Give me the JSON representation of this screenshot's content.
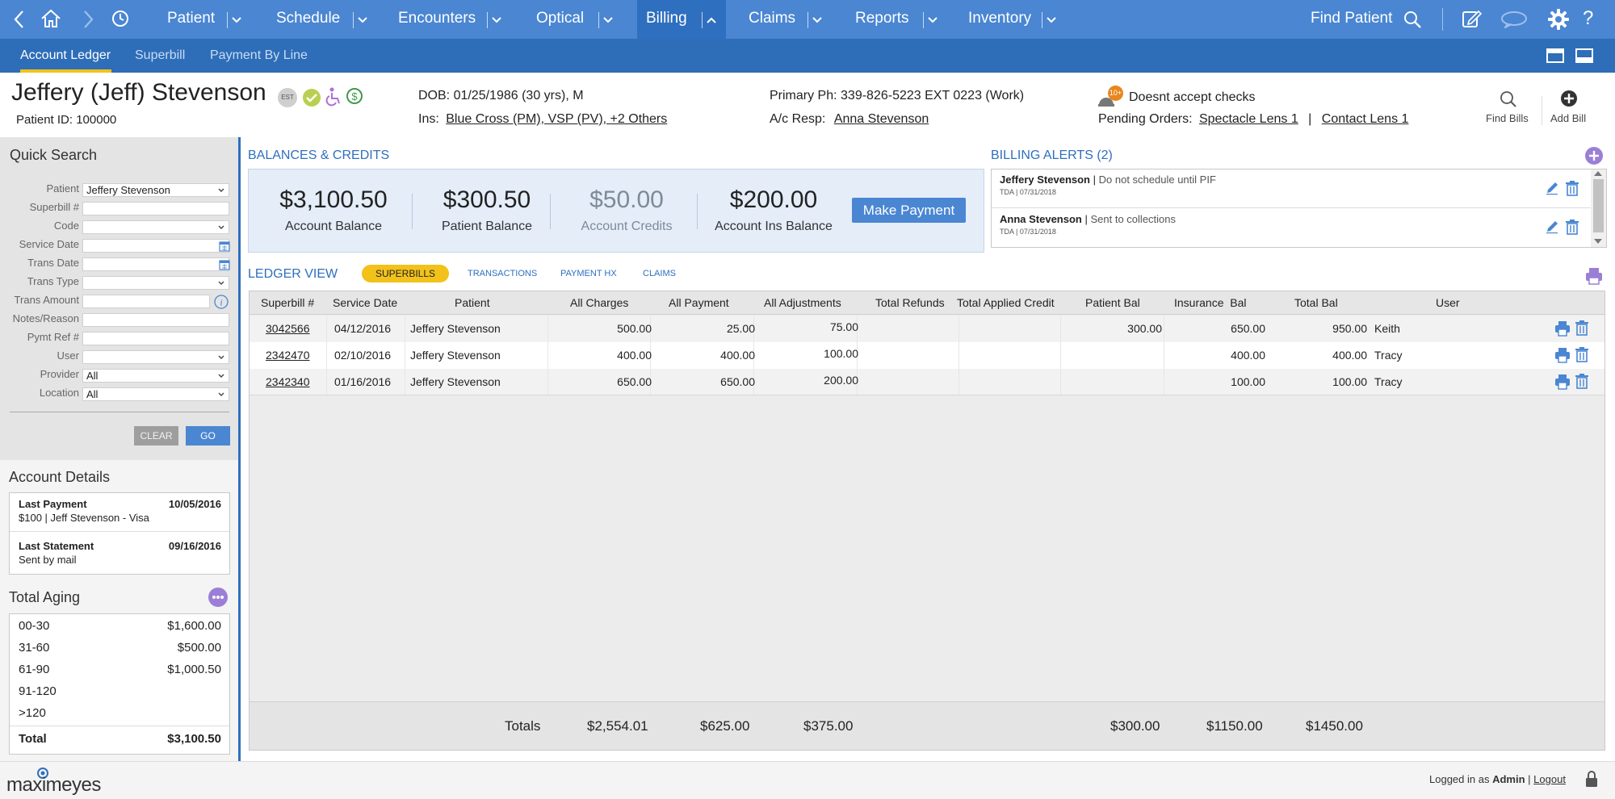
{
  "topnav": {
    "items": [
      {
        "label": "Patient"
      },
      {
        "label": "Schedule"
      },
      {
        "label": "Encounters"
      },
      {
        "label": "Optical"
      },
      {
        "label": "Billing"
      },
      {
        "label": "Claims"
      },
      {
        "label": "Reports"
      },
      {
        "label": "Inventory"
      }
    ],
    "find_patient": "Find Patient",
    "icons": [
      "back-icon",
      "home-icon",
      "forward-icon",
      "history-icon",
      "search-icon",
      "notes-icon",
      "chat-icon",
      "gear-icon",
      "help-icon"
    ]
  },
  "subnav": {
    "tabs": [
      {
        "label": "Account Ledger",
        "active": true
      },
      {
        "label": "Superbill"
      },
      {
        "label": "Payment By Line"
      }
    ]
  },
  "patient": {
    "name": "Jeffery (Jeff) Stevenson",
    "id_text": "Patient ID: 100000",
    "est_badge": "EST",
    "dob": "DOB: 01/25/1986 (30 yrs), M",
    "ins_label": "Ins:",
    "ins_value": "Blue Cross (PM), VSP (PV), +2 Others",
    "primary_phone": "Primary Ph: 339-826-5223  EXT 0223 (Work)",
    "acresp_label": "A/c Resp:",
    "acresp_value": "Anna Stevenson",
    "notice_badge": "10+",
    "notice": "Doesnt accept checks",
    "pending_label": "Pending Orders:",
    "pending_1": "Spectacle Lens 1",
    "pending_sep": "|",
    "pending_2": "Contact Lens 1",
    "find_bills": "Find Bills",
    "add_bill": "Add Bill"
  },
  "quick_search": {
    "title": "Quick Search",
    "fields": [
      {
        "label": "Patient",
        "value": "Jeffery Stevenson"
      },
      {
        "label": "Superbill #",
        "value": ""
      },
      {
        "label": "Code",
        "value": ""
      },
      {
        "label": "Service Date",
        "value": ""
      },
      {
        "label": "Trans Date",
        "value": ""
      },
      {
        "label": "Trans Type",
        "value": ""
      },
      {
        "label": "Trans Amount",
        "value": ""
      },
      {
        "label": "Notes/Reason",
        "value": ""
      },
      {
        "label": "Pymt Ref #",
        "value": ""
      },
      {
        "label": "User",
        "value": ""
      },
      {
        "label": "Provider",
        "value": "All"
      },
      {
        "label": "Location",
        "value": "All"
      }
    ],
    "clear": "CLEAR",
    "go": "GO"
  },
  "account_details": {
    "title": "Account Details",
    "last_payment_label": "Last Payment",
    "last_payment_date": "10/05/2016",
    "last_payment_detail": "$100  |  Jeff Stevenson - Visa",
    "last_statement_label": "Last Statement",
    "last_statement_date": "09/16/2016",
    "last_statement_detail": "Sent by mail"
  },
  "total_aging": {
    "title": "Total Aging",
    "rows": [
      {
        "bucket": "00-30",
        "amount": "$1,600.00"
      },
      {
        "bucket": "31-60",
        "amount": "$500.00"
      },
      {
        "bucket": "61-90",
        "amount": "$1,000.50"
      },
      {
        "bucket": "91-120",
        "amount": ""
      },
      {
        "bucket": ">120",
        "amount": ""
      }
    ],
    "total_label": "Total",
    "total_amount": "$3,100.50"
  },
  "balances": {
    "title": "BALANCES & CREDITS",
    "items": [
      {
        "amount": "$3,100.50",
        "label": "Account Balance"
      },
      {
        "amount": "$300.50",
        "label": "Patient Balance"
      },
      {
        "amount": "$50.00",
        "label": "Account Credits"
      },
      {
        "amount": "$200.00",
        "label": "Account Ins Balance"
      }
    ],
    "make_payment": "Make Payment"
  },
  "billing_alerts": {
    "title": "BILLING ALERTS (2)",
    "items": [
      {
        "name": "Jeffery Stevenson",
        "sep": "|",
        "message": "Do not schedule until PIF",
        "meta": "TDA | 07/31/2018"
      },
      {
        "name": "Anna Stevenson",
        "sep": "|",
        "message": "Sent to collections",
        "meta": "TDA | 07/31/2018"
      }
    ]
  },
  "ledger": {
    "title": "LEDGER VIEW",
    "tabs": [
      {
        "label": "SUPERBILLS",
        "active": true
      },
      {
        "label": "TRANSACTIONS"
      },
      {
        "label": "PAYMENT HX"
      },
      {
        "label": "CLAIMS"
      }
    ],
    "columns": [
      "Superbill #",
      "Service Date",
      "Patient",
      "All Charges",
      "All Payment",
      "All Adjustments",
      "Total Refunds",
      "Total Applied Credit",
      "Patient Bal",
      "Insurance  Bal",
      "Total Bal",
      "User"
    ],
    "rows": [
      {
        "superbill": "3042566",
        "service_date": "04/12/2016",
        "patient": "Jeffery Stevenson",
        "charges": "500.00",
        "payment": "25.00",
        "adjustments": "75.00",
        "refunds": "",
        "applied_credit": "",
        "patient_bal": "300.00",
        "ins_bal": "650.00",
        "total_bal": "950.00",
        "user": "Keith"
      },
      {
        "superbill": "2342470",
        "service_date": "02/10/2016",
        "patient": "Jeffery Stevenson",
        "charges": "400.00",
        "payment": "400.00",
        "adjustments": "100.00",
        "refunds": "",
        "applied_credit": "",
        "patient_bal": "",
        "ins_bal": "400.00",
        "total_bal": "400.00",
        "user": "Tracy"
      },
      {
        "superbill": "2342340",
        "service_date": "01/16/2016",
        "patient": "Jeffery Stevenson",
        "charges": "650.00",
        "payment": "650.00",
        "adjustments": "200.00",
        "refunds": "",
        "applied_credit": "",
        "patient_bal": "",
        "ins_bal": "100.00",
        "total_bal": "100.00",
        "user": "Tracy"
      }
    ],
    "totals": {
      "label": "Totals",
      "charges": "$2,554.01",
      "payment": "$625.00",
      "adjustments": "$375.00",
      "patient_bal": "$300.00",
      "ins_bal": "$1150.00",
      "total_bal": "$1450.00"
    }
  },
  "footer": {
    "logo": "maximeyes",
    "logged_in_prefix": "Logged in as",
    "user": "Admin",
    "sep": "|",
    "logout": "Logout"
  },
  "colors": {
    "nav_blue": "#4a86d2",
    "subnav_blue": "#2e6db8",
    "accent_yellow": "#f2c21b",
    "button_blue": "#4a86d2",
    "alert_purple": "#9b7fd6",
    "notice_orange": "#e8871e"
  }
}
